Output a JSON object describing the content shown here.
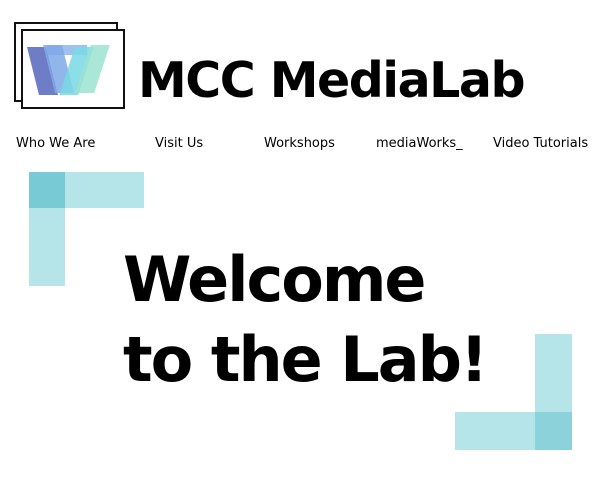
{
  "header": {
    "brand_title": "MCC MediaLab",
    "logo_icon": "medialab-logo-icon"
  },
  "nav": {
    "items": [
      {
        "label": "Who We Are"
      },
      {
        "label": "Visit Us"
      },
      {
        "label": "Workshops"
      },
      {
        "label": "mediaWorks_"
      },
      {
        "label": "Video Tutorials"
      }
    ]
  },
  "hero": {
    "line1": "Welcome",
    "line2": "to the Lab!"
  },
  "colors": {
    "accent": "#78cdd7",
    "text": "#000000",
    "background": "#ffffff"
  }
}
